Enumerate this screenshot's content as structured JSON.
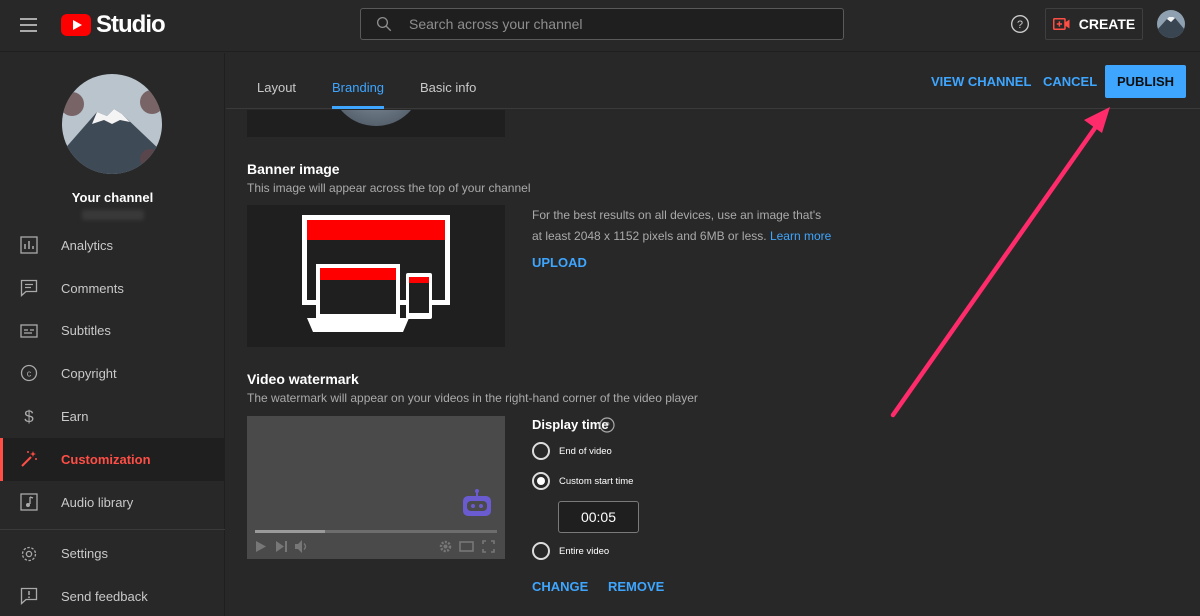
{
  "header": {
    "logo_text": "Studio",
    "search_placeholder": "Search across your channel",
    "create_label": "CREATE"
  },
  "sidebar": {
    "channel_name": "Your channel",
    "items": [
      {
        "label": "Analytics",
        "icon": "analytics-icon"
      },
      {
        "label": "Comments",
        "icon": "comments-icon"
      },
      {
        "label": "Subtitles",
        "icon": "subtitles-icon"
      },
      {
        "label": "Copyright",
        "icon": "copyright-icon"
      },
      {
        "label": "Earn",
        "icon": "dollar-icon"
      },
      {
        "label": "Customization",
        "icon": "magic-wand-icon",
        "active": true
      },
      {
        "label": "Audio library",
        "icon": "audio-library-icon"
      },
      {
        "label": "Settings",
        "icon": "gear-icon"
      },
      {
        "label": "Send feedback",
        "icon": "feedback-icon"
      }
    ]
  },
  "tabs": {
    "items": [
      "Layout",
      "Branding",
      "Basic info"
    ],
    "active": "Branding",
    "view_channel": "VIEW CHANNEL",
    "cancel": "CANCEL",
    "publish": "PUBLISH"
  },
  "banner": {
    "title": "Banner image",
    "description": "This image will appear across the top of your channel",
    "help_text": "For the best results on all devices, use an image that's at least 2048 x 1152 pixels and 6MB or less.",
    "learn_more": "Learn more",
    "upload": "UPLOAD"
  },
  "watermark": {
    "title": "Video watermark",
    "description": "The watermark will appear on your videos in the right-hand corner of the video player",
    "display_time_label": "Display time",
    "options": [
      "End of video",
      "Custom start time",
      "Entire video"
    ],
    "selected_option": "Custom start time",
    "start_time": "00:05",
    "change": "CHANGE",
    "remove": "REMOVE"
  },
  "colors": {
    "accent_blue": "#3ea6ff",
    "active_red": "#ff4e45",
    "brand_red": "#ff0000",
    "annotation_arrow": "#ff2b6a",
    "background": "#282828"
  }
}
